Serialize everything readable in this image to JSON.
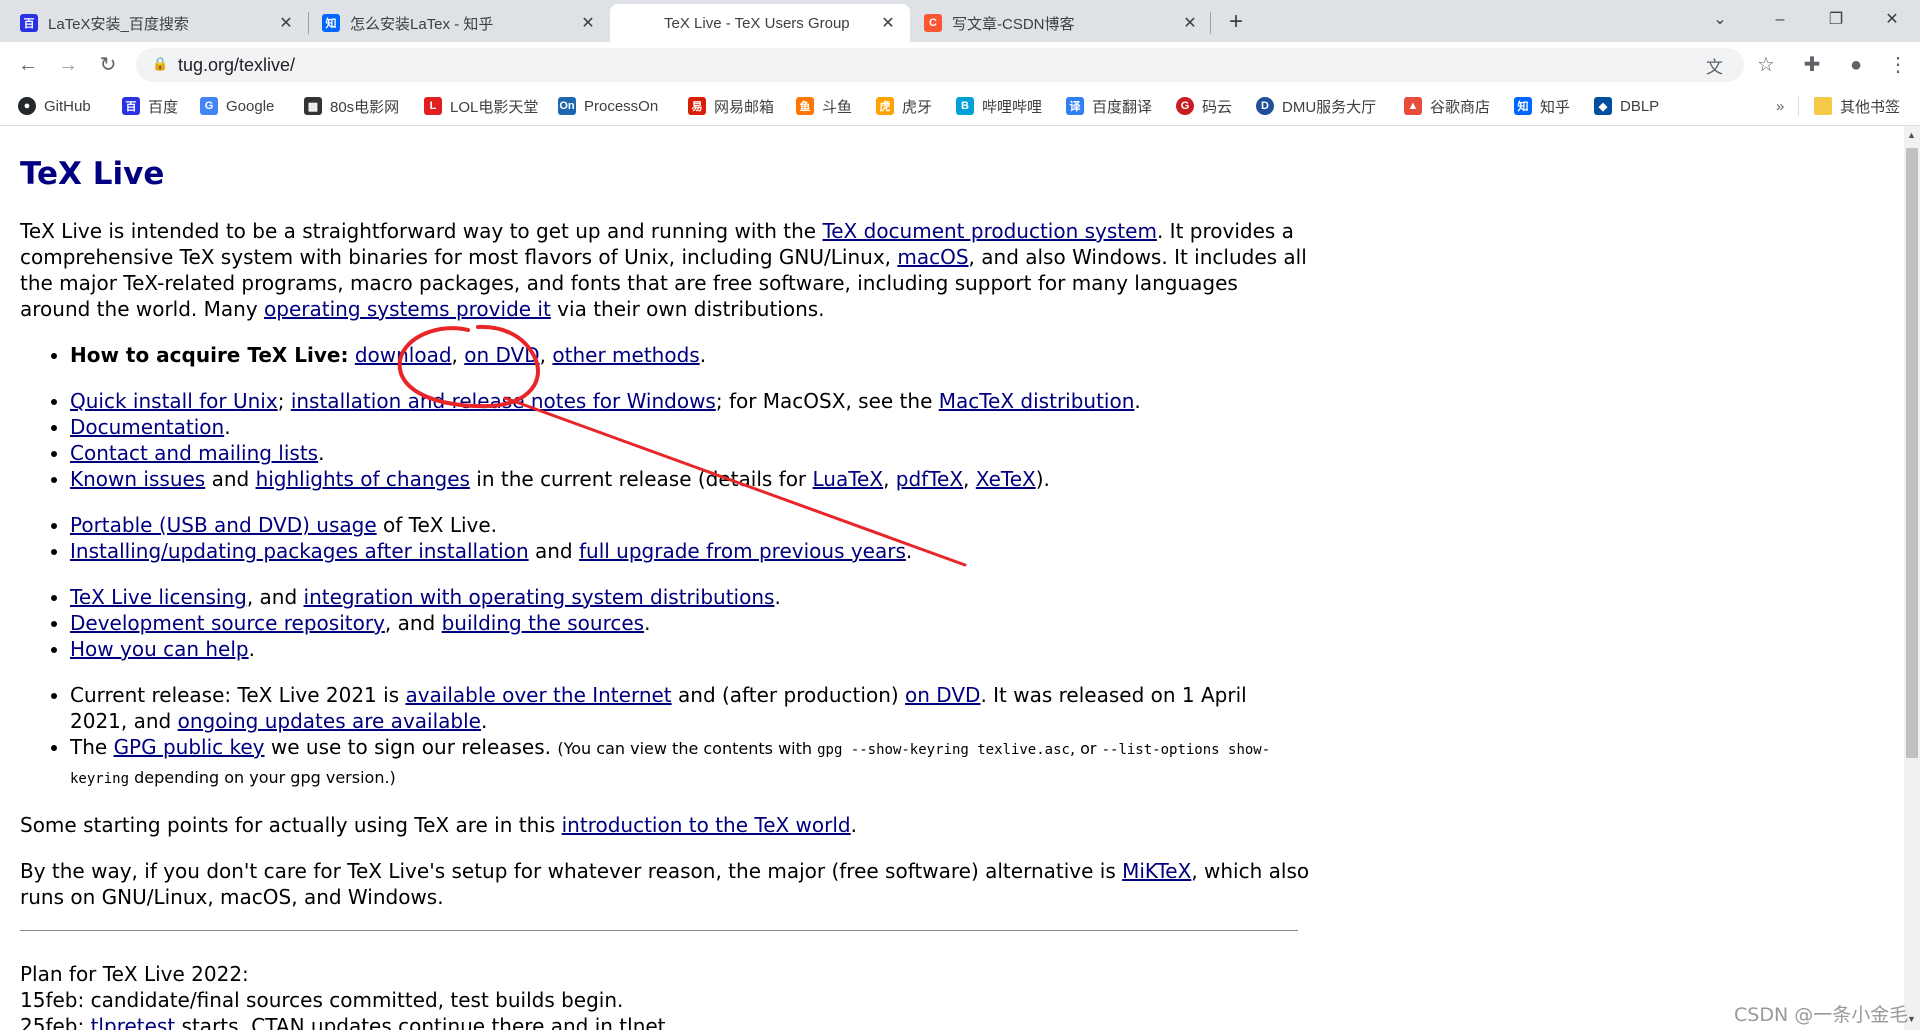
{
  "tabs": [
    {
      "label": "LaTeX安装_百度搜索",
      "icon": "baidu-icon",
      "favtext": "百",
      "color": "#2932e1"
    },
    {
      "label": "怎么安装LaTex - 知乎",
      "icon": "zhihu-icon",
      "favtext": "知",
      "color": "#0066ff"
    },
    {
      "label": "TeX Live - TeX Users Group",
      "icon": "none",
      "favtext": "",
      "color": ""
    },
    {
      "label": "写文章-CSDN博客",
      "icon": "csdn-icon",
      "favtext": "C",
      "color": "#fc5531"
    }
  ],
  "window": {
    "new_tab": "+",
    "dropdown": "⌄",
    "minimize": "–",
    "maximize": "❐",
    "close": "✕",
    "tab_close": "✕"
  },
  "toolbar": {
    "back": "←",
    "forward": "→",
    "reload": "↻",
    "lock": "🔒",
    "url": "tug.org/texlive/",
    "translate": "文",
    "star": "☆",
    "extensions": "✚",
    "profile": "●",
    "menu": "⋮"
  },
  "bookmarks": [
    {
      "label": "GitHub",
      "icon": "github-icon",
      "favtext": "●",
      "color": "#24292e"
    },
    {
      "label": "百度",
      "icon": "baidu-icon",
      "favtext": "百",
      "color": "#2932e1"
    },
    {
      "label": "Google",
      "icon": "google-icon",
      "favtext": "G",
      "color": "#4285f4"
    },
    {
      "label": "80s电影网",
      "icon": "film-icon",
      "favtext": "▦",
      "color": "#333333"
    },
    {
      "label": "LOL电影天堂",
      "icon": "lol-icon",
      "favtext": "L",
      "color": "#e02020"
    },
    {
      "label": "ProcessOn",
      "icon": "processon-icon",
      "favtext": "On",
      "color": "#1d66b0"
    },
    {
      "label": "网易邮箱",
      "icon": "netease-icon",
      "favtext": "易",
      "color": "#d81e06"
    },
    {
      "label": "斗鱼",
      "icon": "douyu-icon",
      "favtext": "鱼",
      "color": "#ff7700"
    },
    {
      "label": "虎牙",
      "icon": "huya-icon",
      "favtext": "虎",
      "color": "#ffa200"
    },
    {
      "label": "哔哩哔哩",
      "icon": "bilibili-icon",
      "favtext": "B",
      "color": "#00a1d6"
    },
    {
      "label": "百度翻译",
      "icon": "baidu-translate-icon",
      "favtext": "译",
      "color": "#2f7ff5"
    },
    {
      "label": "码云",
      "icon": "gitee-icon",
      "favtext": "G",
      "color": "#c71d23"
    },
    {
      "label": "DMU服务大厅",
      "icon": "dmu-icon",
      "favtext": "D",
      "color": "#1f4e9a"
    },
    {
      "label": "谷歌商店",
      "icon": "chrome-store-icon",
      "favtext": "▲",
      "color": "#e84c3d"
    },
    {
      "label": "知乎",
      "icon": "zhihu-icon",
      "favtext": "知",
      "color": "#0066ff"
    },
    {
      "label": "DBLP",
      "icon": "dblp-icon",
      "favtext": "◆",
      "color": "#004f9f"
    }
  ],
  "bookmarks_more": "»",
  "other_bookmarks": "其他书签",
  "page": {
    "heading": "TeX Live",
    "intro": {
      "t1": "TeX Live is intended to be a straightforward way to get up and running with the ",
      "l1": "TeX document production system",
      "t2": ". It provides a comprehensive TeX system with binaries for most flavors of Unix, including GNU/Linux, ",
      "l2": "macOS",
      "t3": ", and also Windows. It includes all the major TeX-related programs, macro packages, and fonts that are free software, including support for many languages around the world. Many ",
      "l3": "operating systems provide it",
      "t4": " via their own distributions."
    },
    "acquire": {
      "label": "How to acquire TeX Live:",
      "l1": "download",
      "l2": "on DVD",
      "l3": "other methods"
    },
    "list2": {
      "quick": "Quick install for Unix",
      "notes": "installation and release notes for Windows",
      "mac_t": "; for MacOSX, see the ",
      "mactex": "MacTeX distribution",
      "docs": "Documentation",
      "contact": "Contact and mailing lists",
      "known": "Known issues",
      "and": " and ",
      "highlights": "highlights of changes",
      "release_t": " in the current release (details for ",
      "luatex": "LuaTeX",
      "pdftex": "pdfTeX",
      "xetex": "XeTeX"
    },
    "list3": {
      "portable": "Portable (USB and DVD) usage",
      "of_t": " of TeX Live.",
      "installing": "Installing/updating packages after installation",
      "full": "full upgrade from previous years"
    },
    "list4": {
      "licensing": "TeX Live licensing",
      "and_t": ", and ",
      "integration": "integration with operating system distributions",
      "devsrc": "Development source repository",
      "building": "building the sources",
      "help": "How you can help"
    },
    "list5": {
      "cur_t1": "Current release: TeX Live 2021 is ",
      "avail": "available over the Internet",
      "cur_t2": " and (after production) ",
      "ondvd": "on DVD",
      "cur_t3": ". It was released on 1 April 2021, and ",
      "ongoing": "ongoing updates are available",
      "gpg_t1": "The ",
      "gpg": "GPG public key",
      "gpg_t2": " we use to sign our releases. ",
      "gpg_s1": "(You can view the contents with ",
      "gpg_c1": "gpg --show-keyring texlive.asc",
      "gpg_s2": ", or ",
      "gpg_c2": "--list-options show-keyring",
      "gpg_s3": " depending on your gpg version.)"
    },
    "starting_t1": "Some starting points for actually using TeX are in this ",
    "starting_link": "introduction to the TeX world",
    "byway_t1": "By the way, if you don't care for TeX Live's setup for whatever reason, the major (free software) alternative is ",
    "miktex": "MiKTeX",
    "byway_t2": ", which also runs on GNU/Linux, macOS, and Windows.",
    "plan_title": "Plan for TeX Live 2022:",
    "plan_line1": "15feb: candidate/final sources committed, test builds begin.",
    "plan_d2": "25feb: ",
    "tlpretest": "tlpretest",
    "plan_t2": " starts, CTAN updates continue there and in tlnet."
  },
  "scroll": {
    "up": "▲",
    "down": "▼"
  },
  "annotation_color": "#e8262a",
  "watermark": "CSDN @一条小金毛"
}
